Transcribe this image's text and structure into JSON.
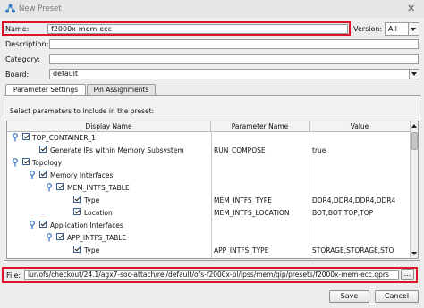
{
  "window": {
    "title": "New Preset"
  },
  "form": {
    "name_label": "Name:",
    "name_value": "f2000x-mem-ecc",
    "version_label": "Version:",
    "version_value": "All",
    "description_label": "Description:",
    "description_value": "",
    "category_label": "Category:",
    "category_value": "",
    "board_label": "Board:",
    "board_value": "default"
  },
  "tabs": [
    {
      "label": "Parameter Settings",
      "active": true
    },
    {
      "label": "Pin Assignments",
      "active": false
    }
  ],
  "panel": {
    "instruction": "Select parameters to include in the preset:"
  },
  "table": {
    "columns": [
      "Display Name",
      "Parameter Name",
      "Value"
    ],
    "rows": [
      {
        "name": "TOP_CONTAINER_1",
        "param": "",
        "value": ""
      },
      {
        "name": "Generate IPs within Memory Subsystem",
        "param": "RUN_COMPOSE",
        "value": "true"
      },
      {
        "name": "Topology",
        "param": "",
        "value": ""
      },
      {
        "name": "Memory Interfaces",
        "param": "",
        "value": ""
      },
      {
        "name": "MEM_INTFS_TABLE",
        "param": "",
        "value": ""
      },
      {
        "name": "Type",
        "param": "MEM_INTFS_TYPE",
        "value": "DDR4,DDR4,DDR4,DDR4"
      },
      {
        "name": "Location",
        "param": "MEM_INTFS_LOCATION",
        "value": "BOT,BOT,TOP,TOP"
      },
      {
        "name": "Application Interfaces",
        "param": "",
        "value": ""
      },
      {
        "name": "APP_INTFS_TABLE",
        "param": "",
        "value": ""
      },
      {
        "name": "Type",
        "param": "APP_INTFS_TYPE",
        "value": "STORAGE,STORAGE,STO"
      }
    ]
  },
  "file": {
    "label": "File:",
    "path": "iur/ofs/checkout/24.1/agx7-soc-attach/rel/default/ofs-f2000x-pl/ipss/mem/qip/presets/f2000x-mem-ecc.qprs",
    "browse_label": "..."
  },
  "buttons": {
    "save": "Save",
    "cancel": "Cancel"
  },
  "colors": {
    "highlight": "#d9162a",
    "pin": "#2f6db5"
  }
}
